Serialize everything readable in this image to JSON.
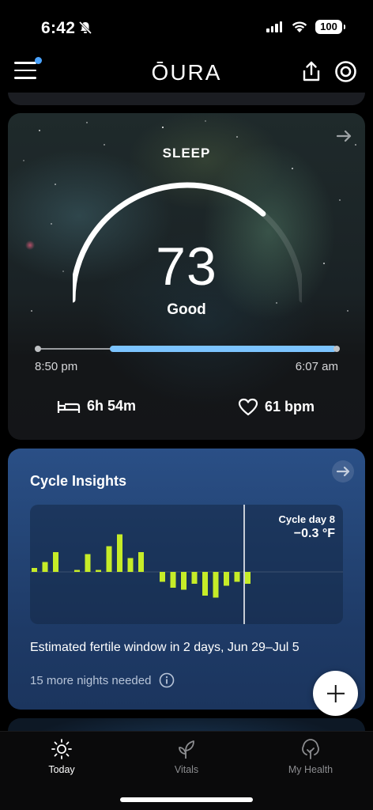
{
  "status_bar": {
    "time": "6:42",
    "battery": "100"
  },
  "header": {
    "logo": "ŌURA",
    "notification_dot_color": "#4aa3ff"
  },
  "sleep_card": {
    "title": "SLEEP",
    "score": "73",
    "rating": "Good",
    "score_value": 73,
    "bedtime_start": "8:50 pm",
    "bedtime_end": "6:07 am",
    "total_sleep": "6h 54m",
    "heart_rate": "61 bpm",
    "accent_color": "#7cc4ff"
  },
  "cycle_card": {
    "title": "Cycle Insights",
    "cycle_day": "Cycle day 8",
    "temperature_deviation": "−0.3 °F",
    "fertile_window_text": "Estimated fertile window in 2 days, Jun 29–Jul 5",
    "nights_needed_text": "15 more nights needed",
    "bar_color": "#c6ec28",
    "bar_values": [
      0.1,
      0.25,
      0.5,
      0,
      0.05,
      0.45,
      0.05,
      0.65,
      0.95,
      0.35,
      0.5,
      0,
      -0.25,
      -0.4,
      -0.45,
      -0.3,
      -0.6,
      -0.65,
      -0.35,
      -0.25,
      -0.3
    ]
  },
  "tabs": [
    {
      "label": "Today",
      "active": true
    },
    {
      "label": "Vitals",
      "active": false
    },
    {
      "label": "My Health",
      "active": false
    }
  ]
}
